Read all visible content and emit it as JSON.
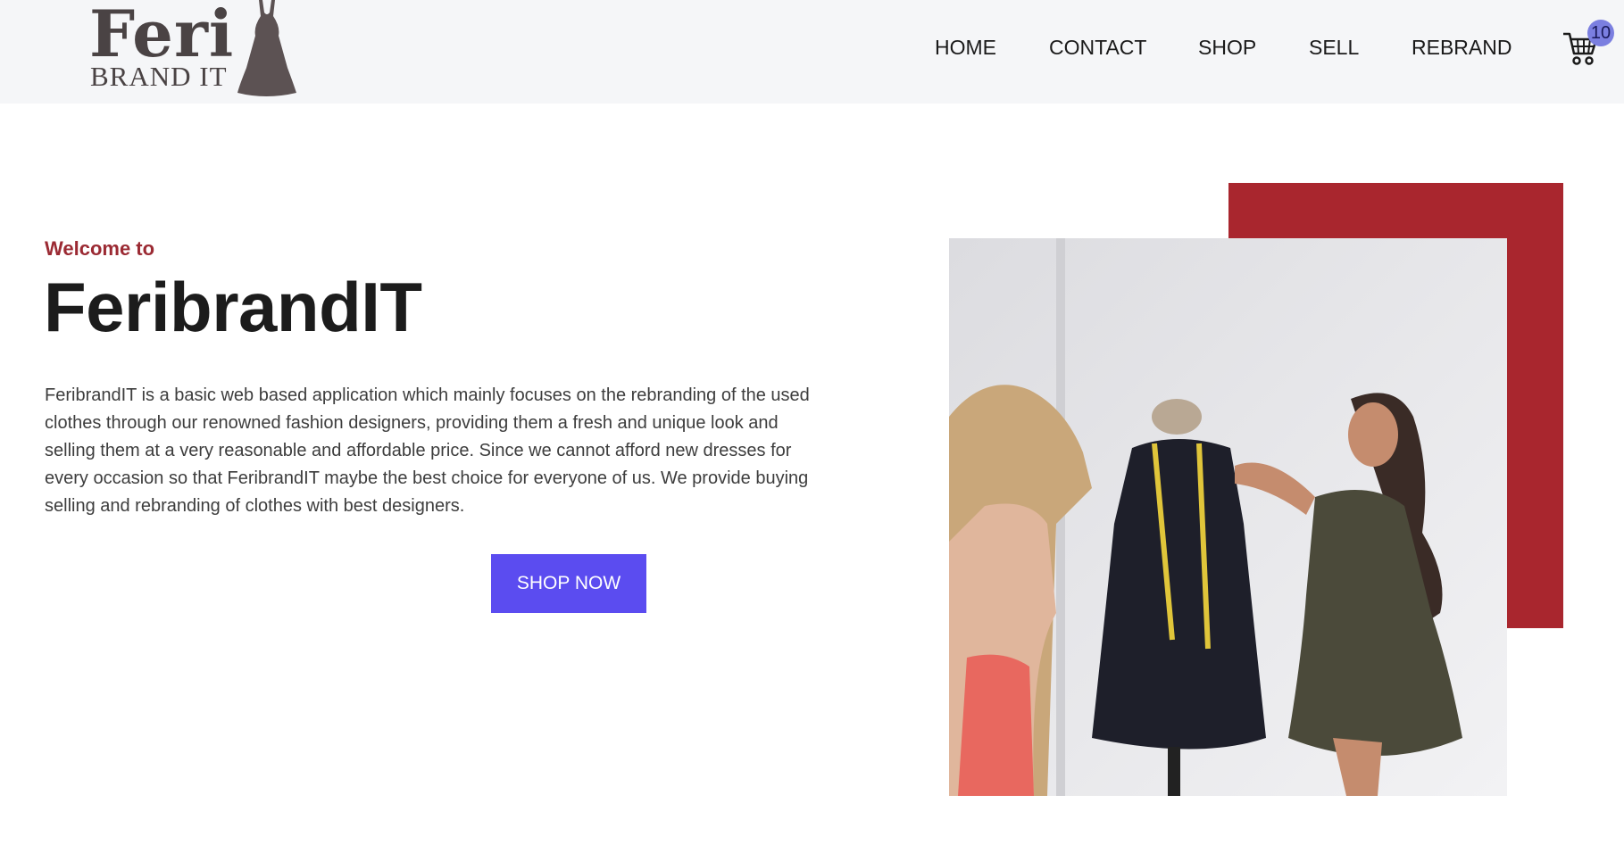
{
  "logo": {
    "primary": "Feri",
    "secondary": "BRAND IT",
    "icon": "dress-icon"
  },
  "nav": {
    "items": [
      {
        "label": "HOME"
      },
      {
        "label": "CONTACT"
      },
      {
        "label": "SHOP"
      },
      {
        "label": "SELL"
      },
      {
        "label": "REBRAND"
      }
    ],
    "cart": {
      "icon": "shopping-cart-icon",
      "count": "10"
    }
  },
  "hero": {
    "welcome": "Welcome to",
    "title": "FeribrandIT",
    "description": "FeribrandIT is a basic web based application which mainly focuses on the rebranding of the used clothes through our renowned fashion designers, providing them a fresh and unique look and selling them at a very reasonable and affordable price. Since we cannot afford new dresses for every occasion so that FeribrandIT maybe the best choice for everyone of us. We provide buying selling and rebranding of clothes with best designers.",
    "cta": "SHOP NOW"
  },
  "colors": {
    "accent": "#5b4cf0",
    "brand_red": "#a9262e",
    "welcome_text": "#9b2a33",
    "header_bg": "#f5f6f8",
    "badge": "#7b7fe0"
  }
}
